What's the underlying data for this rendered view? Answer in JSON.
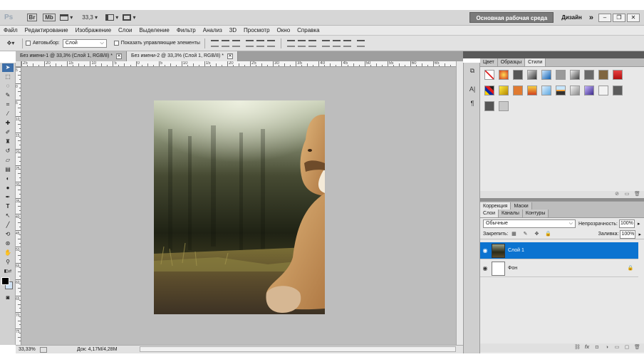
{
  "app": {
    "logo": "Ps",
    "bridge_label": "Br",
    "minibridge_label": "Mb",
    "zoom_value": "33,3",
    "workspace_label": "Основная рабочая среда",
    "design_label": "Дизайн",
    "more_label": "»"
  },
  "menu": [
    "Файл",
    "Редактирование",
    "Изображение",
    "Слои",
    "Выделение",
    "Фильтр",
    "Анализ",
    "3D",
    "Просмотр",
    "Окно",
    "Справка"
  ],
  "options": {
    "autoselect_label": "Автовыбор:",
    "autoselect_value": "Слой",
    "show_controls_label": "Показать управляющие элементы"
  },
  "tabs": [
    {
      "label": "Без имени-1 @ 33,3% (Слой 1, RGB/8) *",
      "active": false
    },
    {
      "label": "Без имени-2 @ 33,3% (Слой 1, RGB/8) *",
      "active": true
    }
  ],
  "ruler_h": [
    "25",
    "20",
    "15",
    "10",
    "5",
    "0",
    "5",
    "10",
    "15",
    "20",
    "25",
    "30",
    "35",
    "40",
    "45",
    "50",
    "55",
    "60",
    "65"
  ],
  "ruler_v": [
    "5",
    "0",
    "5",
    "10",
    "15",
    "20",
    "25",
    "30",
    "35",
    "40",
    "45",
    "50",
    "55",
    "60",
    "65",
    "70",
    "75"
  ],
  "status": {
    "zoom": "33,33%",
    "doc_info": "Док: 4,17M/4,28M"
  },
  "styles_panel": {
    "tabs": [
      "Цвет",
      "Образцы",
      "Стили"
    ],
    "active_tab": 2
  },
  "adjust_panel": {
    "tabs": [
      "Коррекция",
      "Маски"
    ]
  },
  "layers_panel": {
    "tabs": [
      "Слои",
      "Каналы",
      "Контуры"
    ],
    "blend_mode": "Обычные",
    "opacity_label": "Непрозрачность:",
    "opacity_value": "100%",
    "lock_label": "Закрепить:",
    "fill_label": "Заливка:",
    "fill_value": "100%",
    "layers": [
      {
        "name": "Слой 1",
        "selected": true
      },
      {
        "name": "Фон",
        "selected": false
      }
    ]
  },
  "colors": {
    "selection": "#0b73d0",
    "canvas_bg": "#bdbdbd",
    "workspace_btn": "#7a7a7a"
  }
}
